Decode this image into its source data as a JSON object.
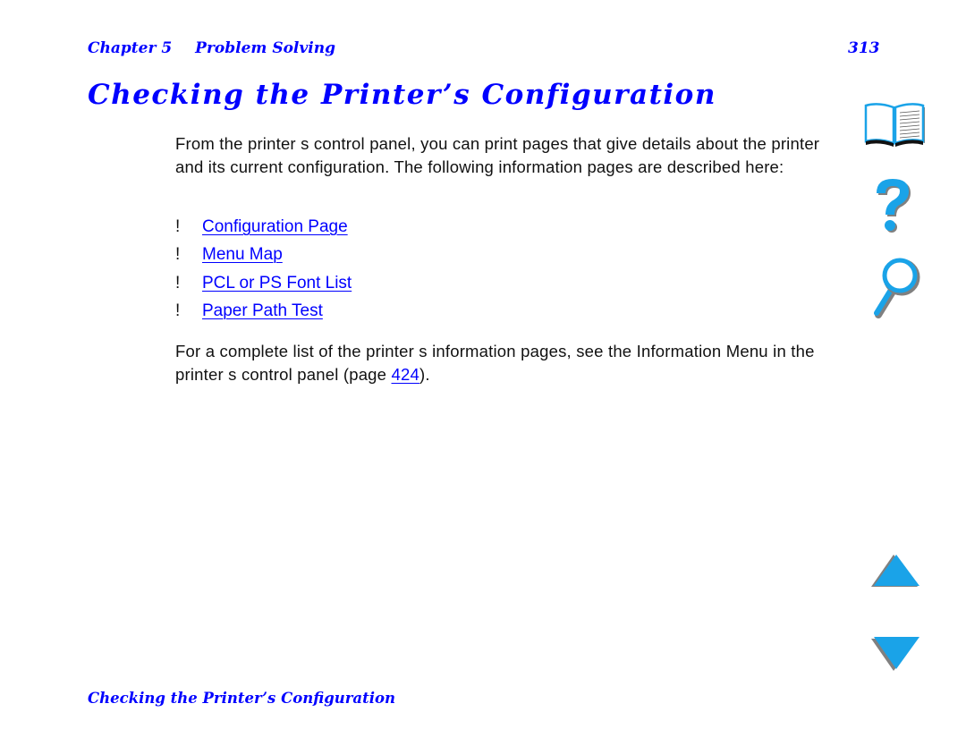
{
  "header": {
    "chapter": "Chapter 5",
    "section": "Problem Solving",
    "page_number": "313"
  },
  "title": "Checking the Printer’s Configuration",
  "intro_paragraph": "From the printer s control panel, you can print pages that give details about the printer and its current configuration. The following information pages are described here:",
  "links": [
    {
      "bullet": "!",
      "label": "Configuration Page"
    },
    {
      "bullet": "!",
      "label": "Menu Map"
    },
    {
      "bullet": "!",
      "label": "PCL or PS Font List"
    },
    {
      "bullet": "!",
      "label": "Paper Path Test"
    }
  ],
  "closing_paragraph": {
    "before": "For a complete list of the printer s information pages, see the Information Menu in the printer s control panel (page ",
    "link": "424",
    "after": ")."
  },
  "footer": "Checking the Printer’s Configuration",
  "nav_icons": [
    "book-icon",
    "help-icon",
    "search-icon",
    "previous-page-icon",
    "next-page-icon"
  ],
  "colors": {
    "text_accent": "#0000ff",
    "icon_fill": "#1aa3e8",
    "icon_shadow": "#808080"
  }
}
